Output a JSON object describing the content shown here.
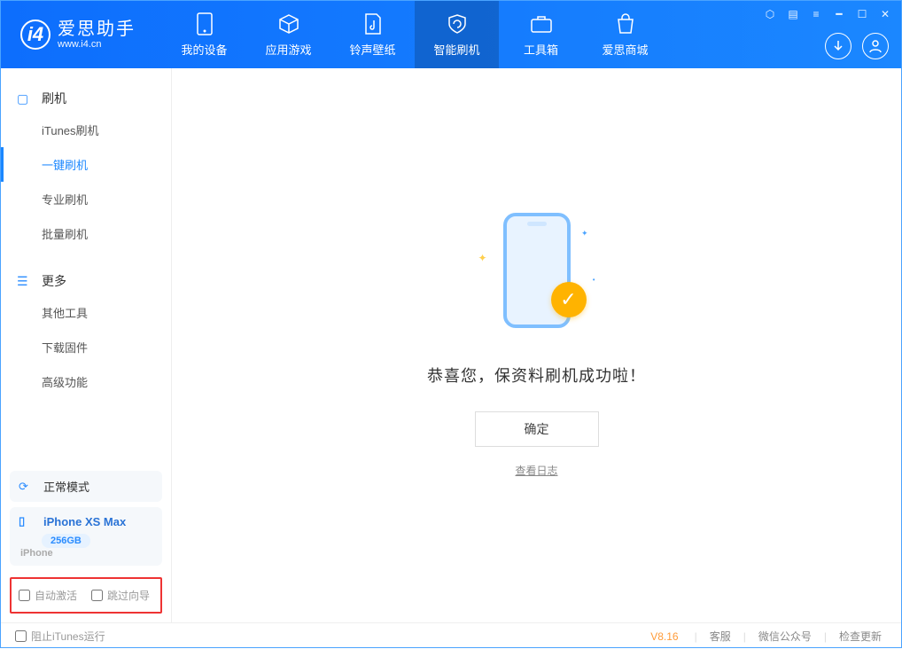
{
  "app": {
    "name_cn": "爱思助手",
    "url": "www.i4.cn"
  },
  "tabs": [
    {
      "label": "我的设备"
    },
    {
      "label": "应用游戏"
    },
    {
      "label": "铃声壁纸"
    },
    {
      "label": "智能刷机"
    },
    {
      "label": "工具箱"
    },
    {
      "label": "爱思商城"
    }
  ],
  "sidebar": {
    "flash_header": "刷机",
    "items": [
      {
        "label": "iTunes刷机"
      },
      {
        "label": "一键刷机"
      },
      {
        "label": "专业刷机"
      },
      {
        "label": "批量刷机"
      }
    ],
    "more_header": "更多",
    "more_items": [
      {
        "label": "其他工具"
      },
      {
        "label": "下载固件"
      },
      {
        "label": "高级功能"
      }
    ]
  },
  "device": {
    "mode_label": "正常模式",
    "name": "iPhone XS Max",
    "capacity": "256GB",
    "type": "iPhone"
  },
  "checks": {
    "auto_activate": "自动激活",
    "skip_guide": "跳过向导"
  },
  "main": {
    "success_msg": "恭喜您，保资料刷机成功啦！",
    "ok_btn": "确定",
    "log_link": "查看日志"
  },
  "footer": {
    "block_itunes": "阻止iTunes运行",
    "version": "V8.16",
    "links": [
      "客服",
      "微信公众号",
      "检查更新"
    ]
  }
}
